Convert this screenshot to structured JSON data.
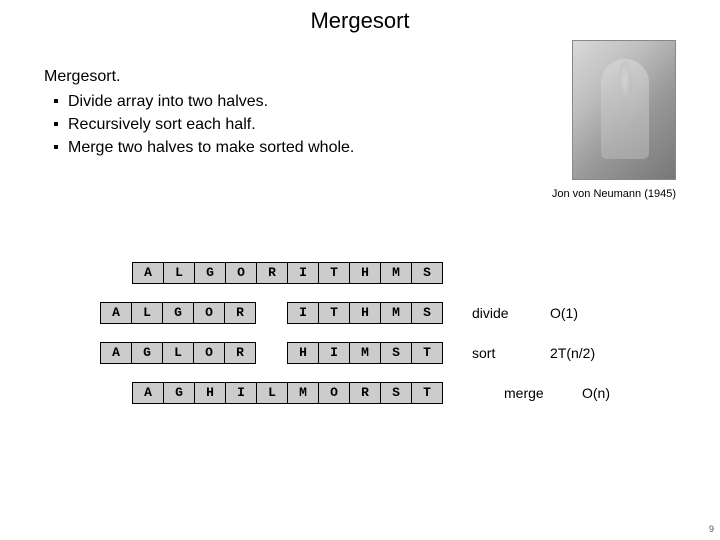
{
  "title": "Mergesort",
  "heading": "Mergesort.",
  "bullets": [
    "Divide array into two halves.",
    "Recursively sort each half.",
    "Merge two halves to make sorted whole."
  ],
  "caption": "Jon von Neumann (1945)",
  "rows": [
    {
      "offset": "row0",
      "left": [
        "A",
        "L",
        "G",
        "O",
        "R"
      ],
      "right": [
        "I",
        "T",
        "H",
        "M",
        "S"
      ],
      "gap": false,
      "label": "",
      "complexity": ""
    },
    {
      "offset": "row1",
      "left": [
        "A",
        "L",
        "G",
        "O",
        "R"
      ],
      "right": [
        "I",
        "T",
        "H",
        "M",
        "S"
      ],
      "gap": true,
      "label": "divide",
      "complexity": "O(1)"
    },
    {
      "offset": "row2",
      "left": [
        "A",
        "G",
        "L",
        "O",
        "R"
      ],
      "right": [
        "H",
        "I",
        "M",
        "S",
        "T"
      ],
      "gap": true,
      "label": "sort",
      "complexity": "2T(n/2)"
    },
    {
      "offset": "row3",
      "left": [
        "A",
        "G",
        "H",
        "I",
        "L"
      ],
      "right": [
        "M",
        "O",
        "R",
        "S",
        "T"
      ],
      "gap": false,
      "label": "merge",
      "complexity": "O(n)"
    }
  ],
  "pagenum": "9"
}
